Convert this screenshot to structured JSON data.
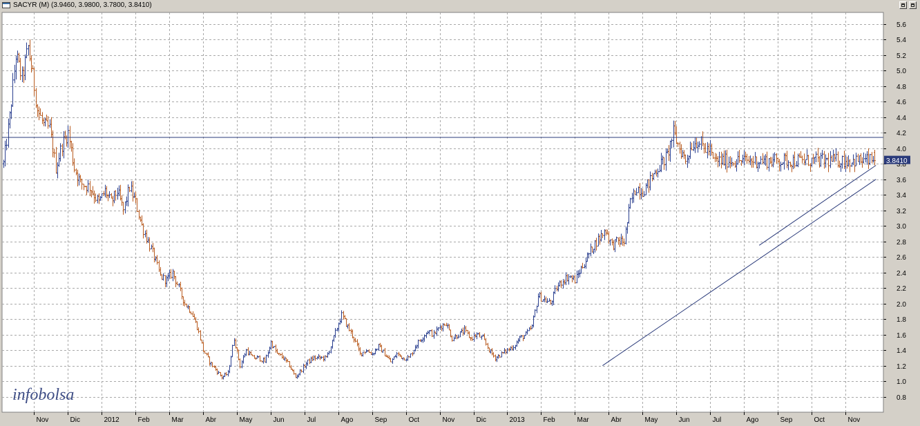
{
  "window": {
    "title": "SACYR (M) (3.9460, 3.9800, 3.7800, 3.8410)"
  },
  "logo": {
    "text": "infobolsa"
  },
  "colors": {
    "up": "#2a3f8f",
    "down": "#b85a1e",
    "grid": "#a8a8a8",
    "line": "#2a3a7a",
    "price_tag_bg": "#2a3a7a"
  },
  "chart_data": {
    "type": "ohlc",
    "symbol": "SACYR (M)",
    "last_bar": {
      "open": 3.946,
      "high": 3.98,
      "low": 3.78,
      "close": 3.841
    },
    "last_price_label": "3.8410",
    "ylim": [
      0.6,
      5.75
    ],
    "y_ticks": [
      0.8,
      1.0,
      1.2,
      1.4,
      1.6,
      1.8,
      2.0,
      2.2,
      2.4,
      2.6,
      2.8,
      3.0,
      3.2,
      3.4,
      3.6,
      3.8,
      4.0,
      4.2,
      4.4,
      4.6,
      4.8,
      5.0,
      5.2,
      5.4,
      5.6
    ],
    "y_tick_labels": [
      "0.8",
      "1.0",
      "1.2",
      "1.4",
      "1.6",
      "1.8",
      "2.0",
      "2.2",
      "2.4",
      "2.6",
      "2.8",
      "3.0",
      "3.2",
      "3.4",
      "3.6",
      "3.8",
      "4.0",
      "4.2",
      "4.4",
      "4.6",
      "4.8",
      "5.0",
      "5.2",
      "5.4",
      "5.6"
    ],
    "x_labels": [
      "Nov",
      "Dic",
      "2012",
      "Feb",
      "Mar",
      "Abr",
      "May",
      "Jun",
      "Jul",
      "Ago",
      "Sep",
      "Oct",
      "Nov",
      "Dic",
      "2013",
      "Feb",
      "Mar",
      "Abr",
      "May",
      "Jun",
      "Jul",
      "Ago",
      "Sep",
      "Oct",
      "Nov"
    ],
    "x_label_index": [
      0,
      22,
      44,
      66,
      88,
      110,
      132,
      154,
      176,
      198,
      220,
      242,
      264,
      286,
      308,
      330,
      352,
      374,
      396,
      418,
      440,
      462,
      484,
      506,
      528
    ],
    "bar_count": 568,
    "first_bar_offset": -20,
    "anchors": [
      [
        -20,
        3.8
      ],
      [
        -16,
        4.4
      ],
      [
        -12,
        5.2
      ],
      [
        -8,
        4.9
      ],
      [
        -4,
        5.3
      ],
      [
        0,
        4.8
      ],
      [
        2,
        4.5
      ],
      [
        6,
        4.3
      ],
      [
        10,
        4.25
      ],
      [
        14,
        3.75
      ],
      [
        18,
        4.05
      ],
      [
        22,
        4.2
      ],
      [
        26,
        3.75
      ],
      [
        30,
        3.55
      ],
      [
        36,
        3.5
      ],
      [
        42,
        3.3
      ],
      [
        46,
        3.45
      ],
      [
        50,
        3.3
      ],
      [
        54,
        3.45
      ],
      [
        58,
        3.2
      ],
      [
        62,
        3.5
      ],
      [
        66,
        3.3
      ],
      [
        70,
        3.0
      ],
      [
        74,
        2.8
      ],
      [
        78,
        2.6
      ],
      [
        82,
        2.35
      ],
      [
        86,
        2.3
      ],
      [
        90,
        2.4
      ],
      [
        94,
        2.2
      ],
      [
        98,
        2.0
      ],
      [
        102,
        1.9
      ],
      [
        106,
        1.7
      ],
      [
        110,
        1.4
      ],
      [
        114,
        1.25
      ],
      [
        118,
        1.15
      ],
      [
        122,
        1.05
      ],
      [
        126,
        1.1
      ],
      [
        130,
        1.55
      ],
      [
        134,
        1.2
      ],
      [
        138,
        1.4
      ],
      [
        142,
        1.3
      ],
      [
        146,
        1.3
      ],
      [
        150,
        1.25
      ],
      [
        154,
        1.5
      ],
      [
        158,
        1.35
      ],
      [
        162,
        1.3
      ],
      [
        166,
        1.2
      ],
      [
        170,
        1.05
      ],
      [
        174,
        1.15
      ],
      [
        178,
        1.25
      ],
      [
        182,
        1.3
      ],
      [
        186,
        1.3
      ],
      [
        190,
        1.3
      ],
      [
        194,
        1.5
      ],
      [
        198,
        1.75
      ],
      [
        200,
        1.85
      ],
      [
        204,
        1.7
      ],
      [
        208,
        1.55
      ],
      [
        212,
        1.35
      ],
      [
        216,
        1.4
      ],
      [
        220,
        1.35
      ],
      [
        224,
        1.45
      ],
      [
        228,
        1.35
      ],
      [
        232,
        1.25
      ],
      [
        236,
        1.35
      ],
      [
        240,
        1.3
      ],
      [
        244,
        1.3
      ],
      [
        248,
        1.45
      ],
      [
        252,
        1.55
      ],
      [
        256,
        1.65
      ],
      [
        260,
        1.6
      ],
      [
        264,
        1.7
      ],
      [
        268,
        1.75
      ],
      [
        272,
        1.55
      ],
      [
        276,
        1.6
      ],
      [
        280,
        1.65
      ],
      [
        284,
        1.55
      ],
      [
        288,
        1.6
      ],
      [
        292,
        1.55
      ],
      [
        296,
        1.4
      ],
      [
        300,
        1.3
      ],
      [
        304,
        1.35
      ],
      [
        308,
        1.4
      ],
      [
        312,
        1.45
      ],
      [
        316,
        1.55
      ],
      [
        320,
        1.6
      ],
      [
        324,
        1.7
      ],
      [
        328,
        2.1
      ],
      [
        332,
        2.05
      ],
      [
        336,
        2.0
      ],
      [
        340,
        2.2
      ],
      [
        344,
        2.3
      ],
      [
        348,
        2.35
      ],
      [
        352,
        2.3
      ],
      [
        356,
        2.45
      ],
      [
        360,
        2.6
      ],
      [
        364,
        2.75
      ],
      [
        368,
        2.85
      ],
      [
        372,
        2.95
      ],
      [
        376,
        2.75
      ],
      [
        380,
        2.8
      ],
      [
        384,
        2.8
      ],
      [
        388,
        3.3
      ],
      [
        392,
        3.5
      ],
      [
        396,
        3.45
      ],
      [
        400,
        3.55
      ],
      [
        404,
        3.7
      ],
      [
        408,
        3.8
      ],
      [
        412,
        3.9
      ],
      [
        416,
        4.2
      ],
      [
        420,
        4.0
      ],
      [
        424,
        3.85
      ],
      [
        428,
        4.05
      ],
      [
        432,
        4.1
      ],
      [
        436,
        4.0
      ],
      [
        440,
        3.97
      ],
      [
        442,
        3.84
      ]
    ],
    "horizontal_line": 4.14,
    "trendlines": [
      {
        "from": [
          370,
          1.2
        ],
        "to": [
          548,
          3.6
        ]
      },
      {
        "from": [
          472,
          2.75
        ],
        "to": [
          548,
          3.78
        ]
      }
    ],
    "grid": true
  }
}
